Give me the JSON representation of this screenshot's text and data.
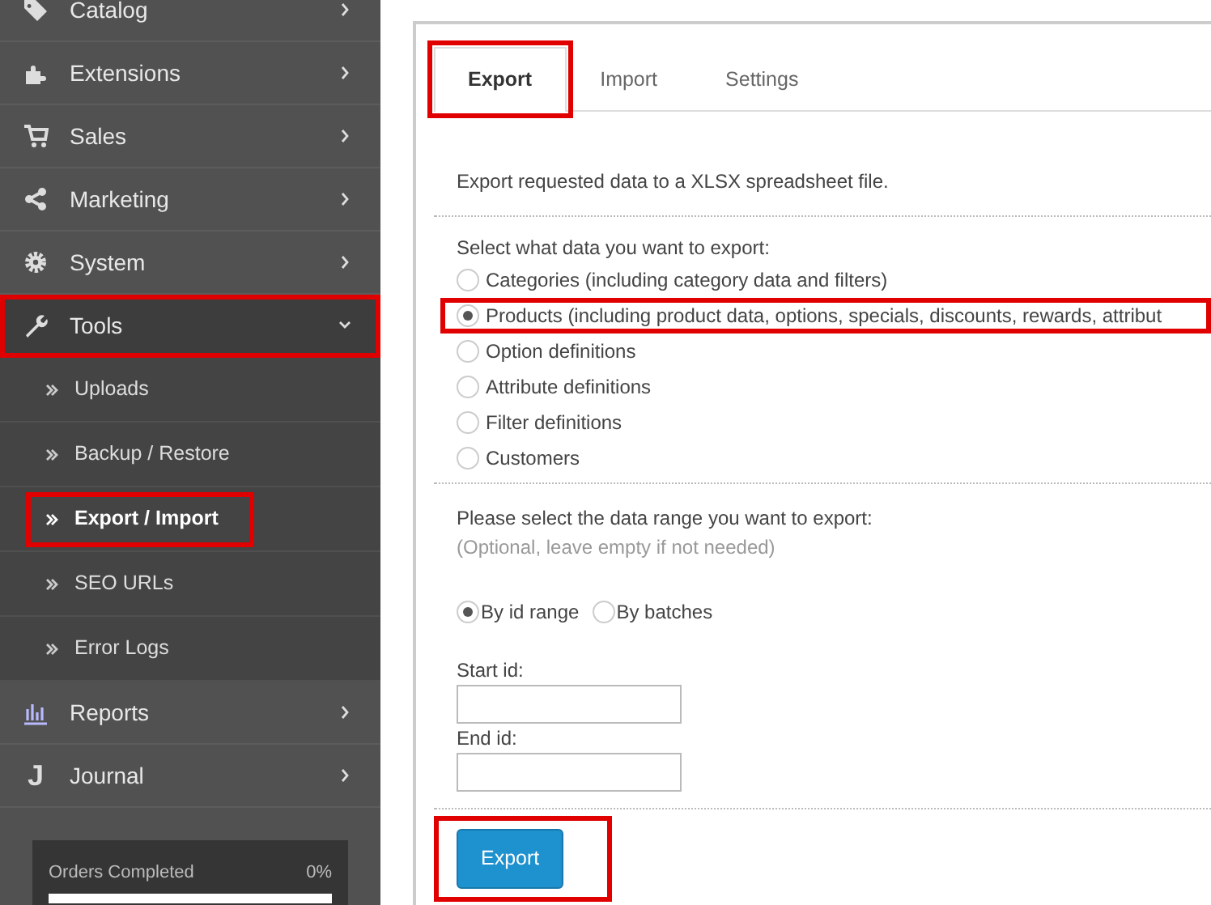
{
  "sidebar": {
    "items": [
      {
        "label": "Catalog",
        "expanded": false,
        "highlighted": false
      },
      {
        "label": "Extensions",
        "expanded": false,
        "highlighted": false
      },
      {
        "label": "Sales",
        "expanded": false,
        "highlighted": false
      },
      {
        "label": "Marketing",
        "expanded": false,
        "highlighted": false
      },
      {
        "label": "System",
        "expanded": false,
        "highlighted": false
      },
      {
        "label": "Tools",
        "expanded": true,
        "highlighted": true,
        "children": [
          {
            "label": "Uploads",
            "selected": false,
            "highlighted": false
          },
          {
            "label": "Backup / Restore",
            "selected": false,
            "highlighted": false
          },
          {
            "label": "Export / Import",
            "selected": true,
            "highlighted": true
          },
          {
            "label": "SEO URLs",
            "selected": false,
            "highlighted": false
          },
          {
            "label": "Error Logs",
            "selected": false,
            "highlighted": false
          }
        ]
      },
      {
        "label": "Reports",
        "expanded": false,
        "highlighted": false
      },
      {
        "label": "Journal",
        "glyph": "J",
        "expanded": false,
        "highlighted": false
      }
    ],
    "progress": {
      "label": "Orders Completed",
      "reading": "0%",
      "level": 0
    }
  },
  "tabs": [
    {
      "label": "Export",
      "selected": true,
      "highlighted": true
    },
    {
      "label": "Import",
      "selected": false,
      "highlighted": false
    },
    {
      "label": "Settings",
      "selected": false,
      "highlighted": false
    }
  ],
  "intro": "Export requested data to a XLSX spreadsheet file.",
  "data_choice": {
    "label": "Select what data you want to export:",
    "options": [
      {
        "label": "Categories (including category data and filters)",
        "selected": false,
        "highlighted": false
      },
      {
        "label": "Products (including product data, options, specials, discounts, rewards, attribut",
        "selected": true,
        "highlighted": true
      },
      {
        "label": "Option definitions",
        "selected": false,
        "highlighted": false
      },
      {
        "label": "Attribute definitions",
        "selected": false,
        "highlighted": false
      },
      {
        "label": "Filter definitions",
        "selected": false,
        "highlighted": false
      },
      {
        "label": "Customers",
        "selected": false,
        "highlighted": false
      }
    ]
  },
  "range": {
    "label": "Please select the data range you want to export:",
    "hint": "(Optional, leave empty if not needed)",
    "modes": [
      {
        "label": "By id range",
        "selected": true
      },
      {
        "label": "By batches",
        "selected": false
      }
    ],
    "fields": [
      {
        "label": "Start id:"
      },
      {
        "label": "End id:"
      }
    ]
  },
  "export_button": {
    "label": "Export",
    "highlighted": true
  }
}
